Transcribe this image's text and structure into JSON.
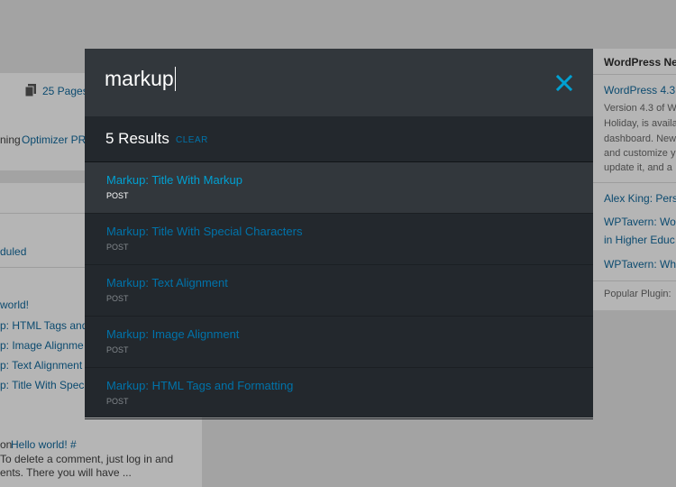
{
  "background": {
    "pages_count": "25 Pages",
    "running_text": "ning",
    "optimizer_link": "Optimizer PR",
    "scheduled": "duled",
    "activity_links": [
      "world!",
      "p: HTML Tags and",
      "p: Image Alignme",
      "p: Text Alignment",
      "p: Title With Spec"
    ],
    "comment_on": "on",
    "comment_link": "Hello world! #",
    "comment_line1": "To delete a comment, just log in and",
    "comment_line2": "ents. There you will have ...",
    "news_title": "WordPress Ne",
    "news_link": "WordPress 4.3",
    "news_desc": [
      "Version 4.3 of W",
      "Holiday, is availa",
      "dashboard. New",
      "and customize y",
      "update it, and a"
    ],
    "news_items": [
      "Alex King: Pers",
      "WPTavern: Wo",
      "in Higher Educ",
      "WPTavern: Wh"
    ],
    "popular_plugin": "Popular Plugin:"
  },
  "search": {
    "query": "markup",
    "results_count": "5 Results",
    "clear_label": "CLEAR",
    "results": [
      {
        "title": "Markup: Title With Markup",
        "type": "POST"
      },
      {
        "title": "Markup: Title With Special Characters",
        "type": "POST"
      },
      {
        "title": "Markup: Text Alignment",
        "type": "POST"
      },
      {
        "title": "Markup: Image Alignment",
        "type": "POST"
      },
      {
        "title": "Markup: HTML Tags and Formatting",
        "type": "POST"
      }
    ]
  },
  "colors": {
    "accent": "#0073aa",
    "accent_active": "#00a0d2",
    "modal_bg": "#23282d",
    "search_bar_bg": "#32373c"
  }
}
